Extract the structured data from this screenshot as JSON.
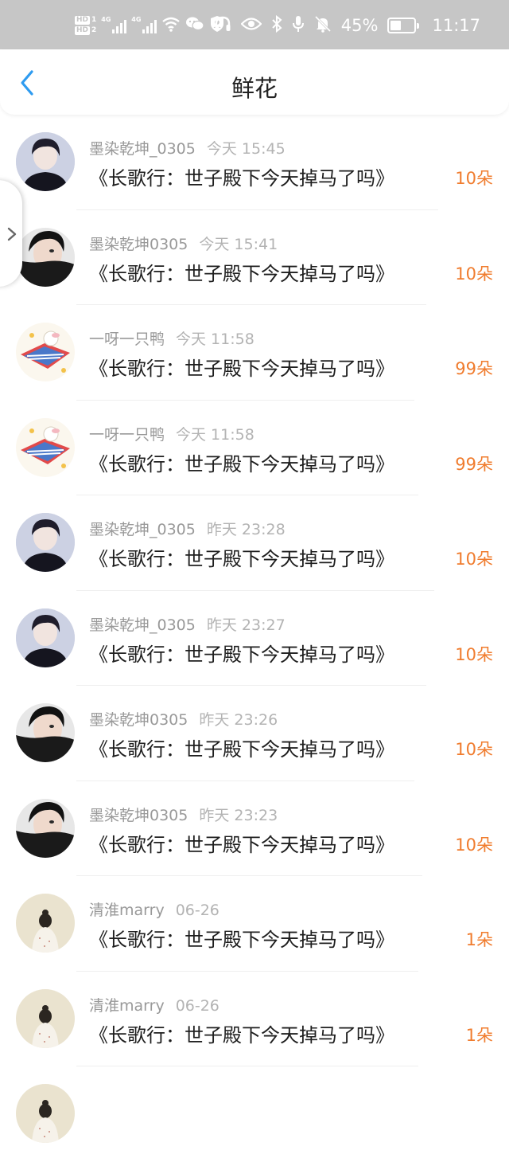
{
  "status_bar": {
    "hd1": "HD",
    "hd1_num": "1",
    "hd2": "HD",
    "hd2_num": "2",
    "net1": "4G",
    "net2": "4G",
    "battery_percent": "45%",
    "battery_level": 0.45,
    "time": "11:17",
    "icons": [
      "signal-icon",
      "wifi-icon",
      "wechat-icon",
      "user-shield-icon",
      "headphones-icon",
      "eye-icon",
      "bluetooth-icon",
      "microphone-icon",
      "bell-off-icon",
      "battery-icon"
    ]
  },
  "nav": {
    "title": "鲜花",
    "back_icon": "chevron-left-icon",
    "accent_color": "#2e9bf0"
  },
  "side_handle": {
    "icon": "chevron-right-icon"
  },
  "colors": {
    "amount": "#f07c2e",
    "meta": "#999999"
  },
  "gifts": [
    {
      "user": "墨染乾坤_0305",
      "time": "今天 15:45",
      "book": "《长歌行：世子殿下今天掉马了吗》",
      "amount": "10朵",
      "avatar": "avatar-a"
    },
    {
      "user": "墨染乾坤0305",
      "time": "今天 15:41",
      "book": "《长歌行：世子殿下今天掉马了吗》",
      "amount": "10朵",
      "avatar": "avatar-b"
    },
    {
      "user": "一呀一只鸭",
      "time": "今天 11:58",
      "book": "《长歌行：世子殿下今天掉马了吗》",
      "amount": "99朵",
      "avatar": "avatar-c"
    },
    {
      "user": "一呀一只鸭",
      "time": "今天 11:58",
      "book": "《长歌行：世子殿下今天掉马了吗》",
      "amount": "99朵",
      "avatar": "avatar-c"
    },
    {
      "user": "墨染乾坤_0305",
      "time": "昨天 23:28",
      "book": "《长歌行：世子殿下今天掉马了吗》",
      "amount": "10朵",
      "avatar": "avatar-a"
    },
    {
      "user": "墨染乾坤_0305",
      "time": "昨天 23:27",
      "book": "《长歌行：世子殿下今天掉马了吗》",
      "amount": "10朵",
      "avatar": "avatar-a"
    },
    {
      "user": "墨染乾坤0305",
      "time": "昨天 23:26",
      "book": "《长歌行：世子殿下今天掉马了吗》",
      "amount": "10朵",
      "avatar": "avatar-b"
    },
    {
      "user": "墨染乾坤0305",
      "time": "昨天 23:23",
      "book": "《长歌行：世子殿下今天掉马了吗》",
      "amount": "10朵",
      "avatar": "avatar-b"
    },
    {
      "user": "清淮marry",
      "time": "06-26",
      "book": "《长歌行：世子殿下今天掉马了吗》",
      "amount": "1朵",
      "avatar": "avatar-d"
    },
    {
      "user": "清淮marry",
      "time": "06-26",
      "book": "《长歌行：世子殿下今天掉马了吗》",
      "amount": "1朵",
      "avatar": "avatar-d"
    }
  ]
}
